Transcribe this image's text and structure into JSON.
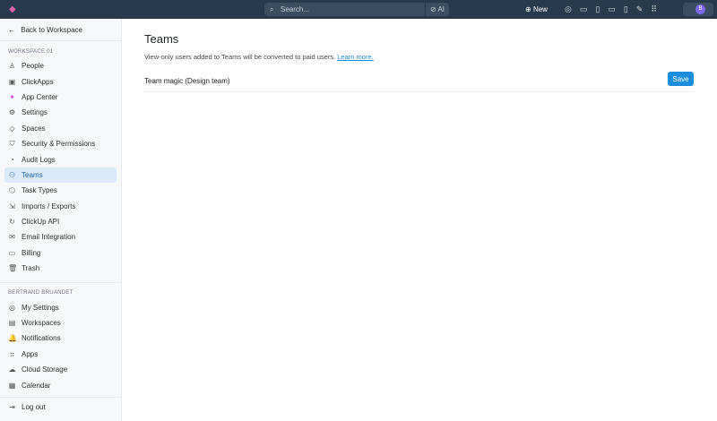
{
  "topbar": {
    "search_placeholder": "Search...",
    "ai_label": "AI",
    "new_label": "New",
    "avatar_initial": "B"
  },
  "sidebar": {
    "back_label": "Back to Workspace",
    "workspace_heading": "WORKSPACE 01",
    "workspace_items": [
      {
        "label": "People",
        "icon": "person-icon"
      },
      {
        "label": "ClickApps",
        "icon": "clickapps-icon"
      },
      {
        "label": "App Center",
        "icon": "star-icon"
      },
      {
        "label": "Settings",
        "icon": "gear-icon"
      },
      {
        "label": "Spaces",
        "icon": "spaces-icon"
      },
      {
        "label": "Security & Permissions",
        "icon": "shield-icon"
      },
      {
        "label": "Audit Logs",
        "icon": "clock-icon"
      },
      {
        "label": "Teams",
        "icon": "teams-icon"
      },
      {
        "label": "Task Types",
        "icon": "cube-icon"
      },
      {
        "label": "Imports / Exports",
        "icon": "import-icon"
      },
      {
        "label": "ClickUp API",
        "icon": "api-icon"
      },
      {
        "label": "Email Integration",
        "icon": "mail-icon"
      },
      {
        "label": "Billing",
        "icon": "card-icon"
      },
      {
        "label": "Trash",
        "icon": "trash-icon"
      }
    ],
    "user_heading": "BERTRAND BRUANDET",
    "user_items": [
      {
        "label": "My Settings"
      },
      {
        "label": "Workspaces"
      },
      {
        "label": "Notifications"
      },
      {
        "label": "Apps"
      },
      {
        "label": "Cloud Storage"
      },
      {
        "label": "Calendar"
      }
    ],
    "logout_label": "Log out"
  },
  "main": {
    "title": "Teams",
    "description": "View-only users added to Teams will be converted to paid users.",
    "learn_more": "Learn more.",
    "team_name_value": "Team magic (Design team)",
    "save_label": "Save"
  }
}
